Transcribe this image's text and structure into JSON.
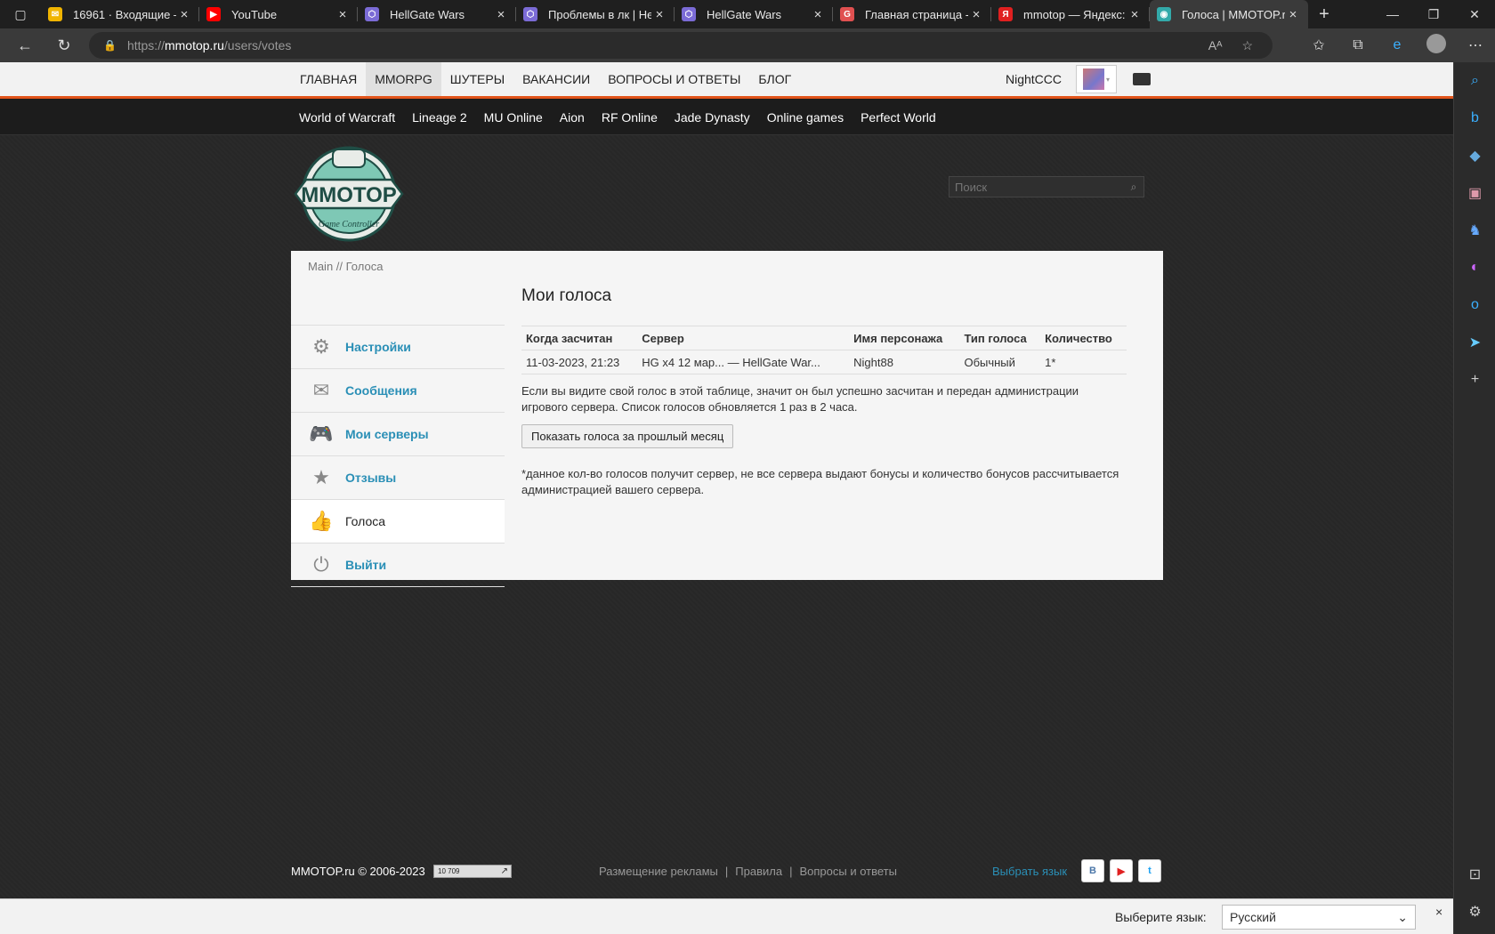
{
  "browser": {
    "tabs": [
      {
        "title": "16961 · Входящие —",
        "favicon_color": "#f0b400",
        "favicon_glyph": "✉"
      },
      {
        "title": "YouTube",
        "favicon_color": "#ff0000",
        "favicon_glyph": "▶"
      },
      {
        "title": "HellGate Wars",
        "favicon_color": "#7b6bd6",
        "favicon_glyph": "⬡"
      },
      {
        "title": "Проблемы в лк | Hel",
        "favicon_color": "#7b6bd6",
        "favicon_glyph": "⬡"
      },
      {
        "title": "HellGate Wars",
        "favicon_color": "#7b6bd6",
        "favicon_glyph": "⬡"
      },
      {
        "title": "Главная страница - (",
        "favicon_color": "#e05050",
        "favicon_glyph": "G"
      },
      {
        "title": "mmotop — Яндекс: н",
        "favicon_color": "#e02020",
        "favicon_glyph": "Я"
      },
      {
        "title": "Голоса | MMOTOP.ru",
        "favicon_color": "#3aa",
        "favicon_glyph": "◉"
      }
    ],
    "url_prefix": "https://",
    "url_host": "mmotop.ru",
    "url_path": "/users/votes"
  },
  "site": {
    "topnav": [
      "ГЛАВНАЯ",
      "MMORPG",
      "ШУТЕРЫ",
      "ВАКАНСИИ",
      "ВОПРОСЫ И ОТВЕТЫ",
      "БЛОГ"
    ],
    "username": "NightCCC",
    "gamenav": [
      "World of Warcraft",
      "Lineage 2",
      "MU Online",
      "Aion",
      "RF Online",
      "Jade Dynasty",
      "Online games",
      "Perfect World"
    ],
    "logo_text": "MMOTOP",
    "logo_sub": "Game Controller",
    "search_placeholder": "Поиск",
    "breadcrumb": "Main // Голоса",
    "menu": [
      {
        "label": "Настройки",
        "icon": "gear-icon"
      },
      {
        "label": "Сообщения",
        "icon": "envelope-icon"
      },
      {
        "label": "Мои серверы",
        "icon": "gamepad-icon"
      },
      {
        "label": "Отзывы",
        "icon": "star-icon"
      },
      {
        "label": "Голоса",
        "icon": "thumbs-up-icon"
      },
      {
        "label": "Выйти",
        "icon": "power-icon"
      }
    ],
    "page_title": "Мои голоса",
    "table": {
      "headers": [
        "Когда засчитан",
        "Сервер",
        "Имя персонажа",
        "Тип голоса",
        "Количество"
      ],
      "rows": [
        [
          "11-03-2023, 21:23",
          "HG x4 12 мар... — HellGate War...",
          "Night88",
          "Обычный",
          "1*"
        ]
      ]
    },
    "note": "Если вы видите свой голос в этой таблице, значит он был успешно засчитан и передан администрации игрового сервера. Список голосов обновляется 1 раз в 2 часа.",
    "button_label": "Показать голоса за прошлый месяц",
    "footnote": "*данное кол-во голосов получит сервер, не все сервера выдают бонусы и количество бонусов рассчитывается администрацией вашего сервера.",
    "footer": {
      "copyright": "MMOTOP.ru © 2006-2023",
      "counter": "10 709",
      "links": [
        "Размещение рекламы",
        "Правила",
        "Вопросы и ответы"
      ],
      "language_link": "Выбрать язык",
      "social": [
        "В",
        "▶",
        "t"
      ]
    },
    "language_bar": {
      "label": "Выберите язык:",
      "selected": "Русский",
      "close": "×"
    }
  },
  "colors": {
    "accent": "#e2541b",
    "link": "#2a8fb6"
  }
}
